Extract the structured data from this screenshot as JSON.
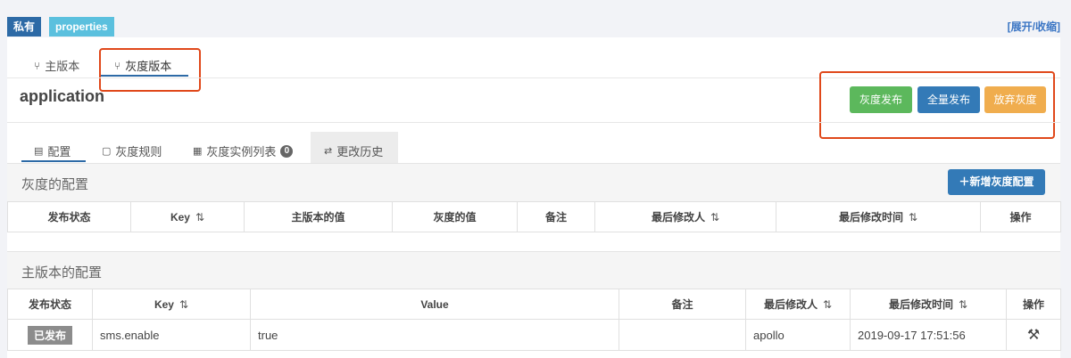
{
  "namespace": {
    "scope_badge": "私有",
    "format_badge": "properties",
    "toggle_link": "[展开/收缩]"
  },
  "version_tabs": [
    {
      "label": "主版本"
    },
    {
      "label": "灰度版本"
    }
  ],
  "app_name": "application",
  "actions": {
    "gray_publish": "灰度发布",
    "full_publish": "全量发布",
    "abandon_gray": "放弃灰度"
  },
  "sub_tabs": [
    {
      "label": "配置"
    },
    {
      "label": "灰度规则"
    },
    {
      "label": "灰度实例列表",
      "count": "0"
    },
    {
      "label": "更改历史"
    }
  ],
  "gray_config": {
    "title": "灰度的配置",
    "add_button": "新增灰度配置",
    "headers": [
      "发布状态",
      "Key",
      "主版本的值",
      "灰度的值",
      "备注",
      "最后修改人",
      "最后修改时间",
      "操作"
    ]
  },
  "main_config": {
    "title": "主版本的配置",
    "headers": [
      "发布状态",
      "Key",
      "Value",
      "备注",
      "最后修改人",
      "最后修改时间",
      "操作"
    ],
    "rows": [
      {
        "status": "已发布",
        "key": "sms.enable",
        "value": "true",
        "comment": "",
        "modifier": "apollo",
        "time": "2019-09-17 17:51:56"
      }
    ]
  },
  "colors": {
    "primary": "#337ab7",
    "success": "#5cb85c",
    "warning": "#f0ad4e",
    "highlight": "#e0481a"
  }
}
